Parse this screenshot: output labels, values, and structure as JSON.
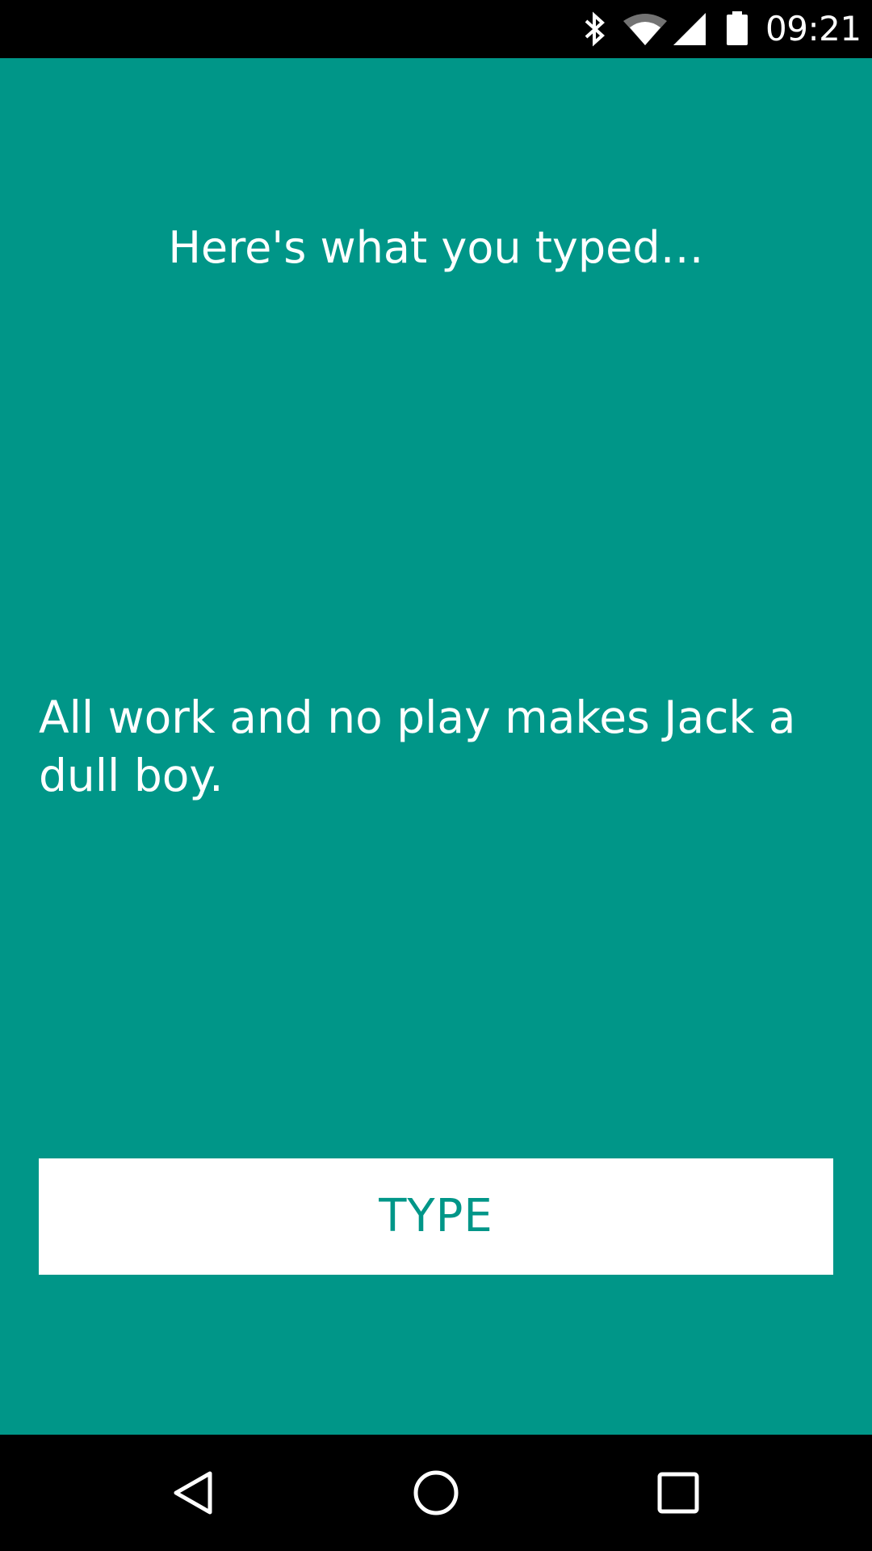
{
  "status_bar": {
    "time": "09:21",
    "icons": [
      "bluetooth-icon",
      "wifi-icon",
      "cell-signal-icon",
      "battery-icon"
    ]
  },
  "app": {
    "background_color": "#009688",
    "heading": "Here's what you typed…",
    "typed_text": "All work and no play makes Jack a dull boy.",
    "button_label": "TYPE",
    "button_text_color": "#009688"
  },
  "nav_bar": {
    "icons": [
      "back-icon",
      "home-icon",
      "recents-icon"
    ]
  }
}
